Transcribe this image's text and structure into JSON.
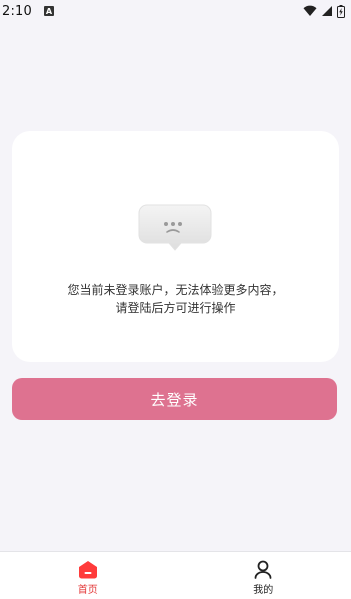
{
  "status_bar": {
    "time": "2:10",
    "notification_badge": "A",
    "icons": [
      "wifi-icon",
      "signal-icon",
      "battery-icon"
    ]
  },
  "empty_state": {
    "icon": "sad-chat-bubble-icon",
    "message_line1": "您当前未登录账户，无法体验更多内容，",
    "message_line2": "请登陆后方可进行操作"
  },
  "login_button": {
    "label": "去登录",
    "color": "#de7290"
  },
  "tab_bar": {
    "tabs": [
      {
        "label": "首页",
        "icon": "home-icon",
        "active": true
      },
      {
        "label": "我的",
        "icon": "user-icon",
        "active": false
      }
    ],
    "active_color": "#e33a3a"
  }
}
